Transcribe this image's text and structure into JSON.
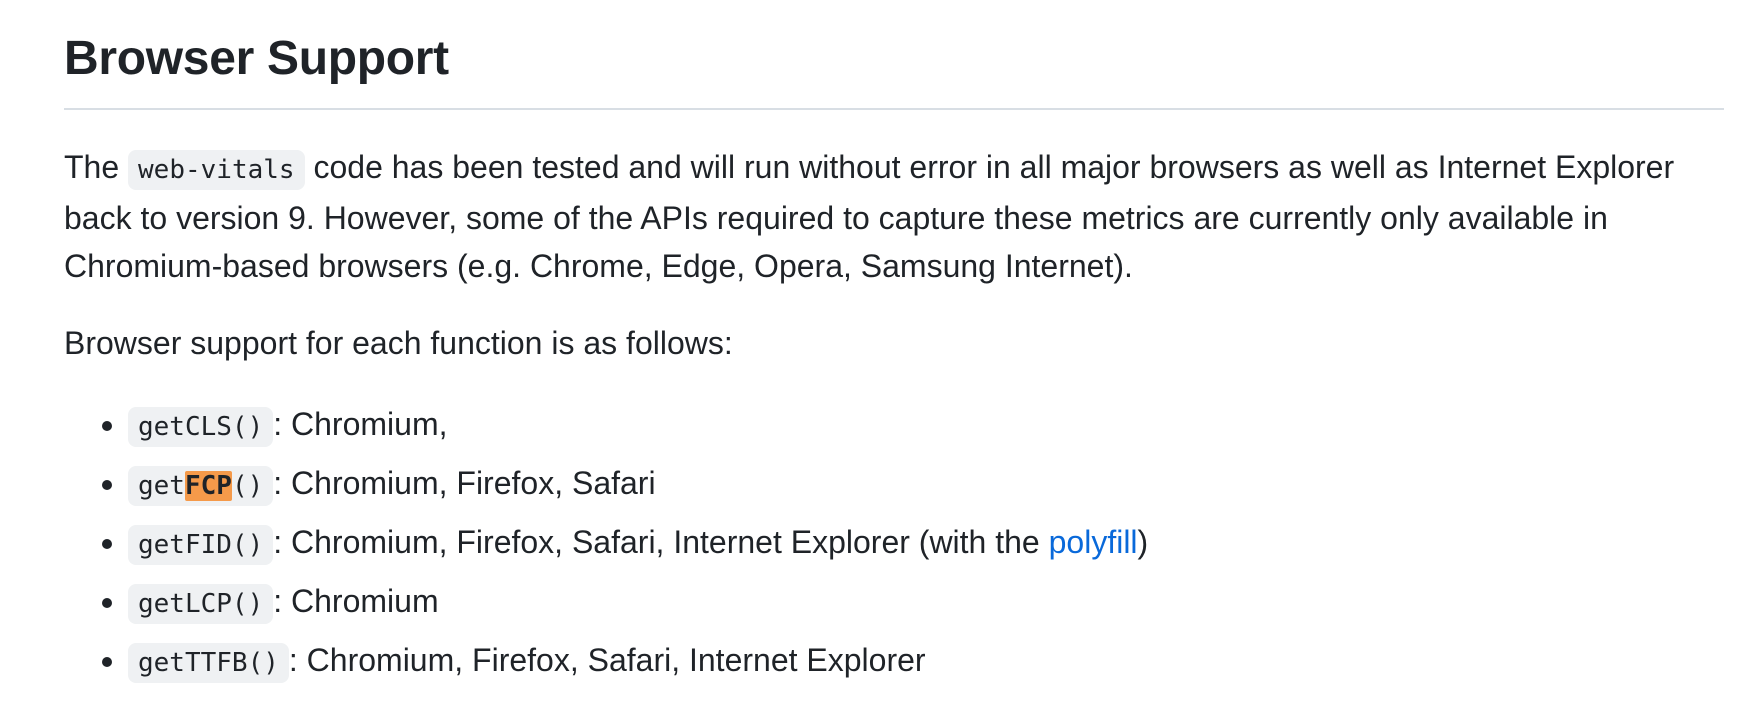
{
  "heading": "Browser Support",
  "intro": {
    "before_code": "The ",
    "code": "web-vitals",
    "line1_rest": " code has been tested and will run without error in all major browsers as well as Internet Explorer",
    "line2": "back to version 9. However, some of the APIs required to capture these metrics are currently only available in",
    "line3": "Chromium-based browsers (e.g. Chrome, Edge, Opera, Samsung Internet)."
  },
  "support_intro": "Browser support for each function is as follows:",
  "functions": [
    {
      "code": "getCLS()",
      "support": ": Chromium,"
    },
    {
      "code_prefix": "get",
      "code_highlight": "FCP",
      "code_suffix": "()",
      "support": ": Chromium, Firefox, Safari"
    },
    {
      "code": "getFID()",
      "support": ": Chromium, Firefox, Safari, Internet Explorer (with the ",
      "link": "polyfill",
      "after_link": ")"
    },
    {
      "code": "getLCP()",
      "support": ": Chromium"
    },
    {
      "code": "getTTFB()",
      "support": ": Chromium, Firefox, Safari, Internet Explorer"
    }
  ],
  "colors": {
    "link": "#0969da",
    "highlight": "#f59a4a",
    "code_background": "#eff1f3"
  }
}
